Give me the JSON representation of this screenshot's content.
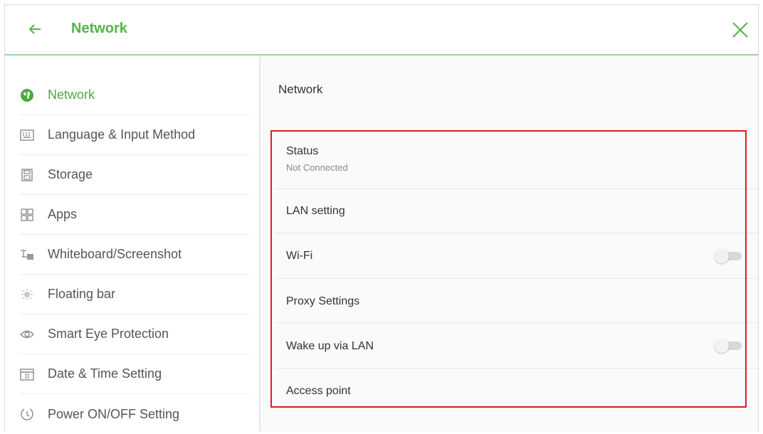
{
  "header": {
    "title": "Network",
    "accent_color": "#52b545",
    "back_icon": "arrow-left-icon",
    "close_icon": "close-icon"
  },
  "sidebar": {
    "items": [
      {
        "label": "Network",
        "icon": "globe-icon",
        "active": true
      },
      {
        "label": "Language & Input Method",
        "icon": "keyboard-icon"
      },
      {
        "label": "Storage",
        "icon": "storage-icon"
      },
      {
        "label": "Apps",
        "icon": "apps-grid-icon"
      },
      {
        "label": "Whiteboard/Screenshot",
        "icon": "whiteboard-icon"
      },
      {
        "label": "Floating bar",
        "icon": "floating-bar-icon"
      },
      {
        "label": "Smart Eye Protection",
        "icon": "eye-icon"
      },
      {
        "label": "Date & Time Setting",
        "icon": "calendar-icon"
      },
      {
        "label": "Power ON/OFF Setting",
        "icon": "power-timer-icon"
      }
    ]
  },
  "main": {
    "title": "Network",
    "rows": [
      {
        "label": "Status",
        "sub": "Not Connected"
      },
      {
        "label": "LAN setting"
      },
      {
        "label": "Wi-Fi",
        "toggle": "off"
      },
      {
        "label": "Proxy Settings"
      },
      {
        "label": "Wake up via LAN",
        "toggle": "off"
      },
      {
        "label": "Access point"
      }
    ]
  },
  "highlight_color": "#e21b1b"
}
